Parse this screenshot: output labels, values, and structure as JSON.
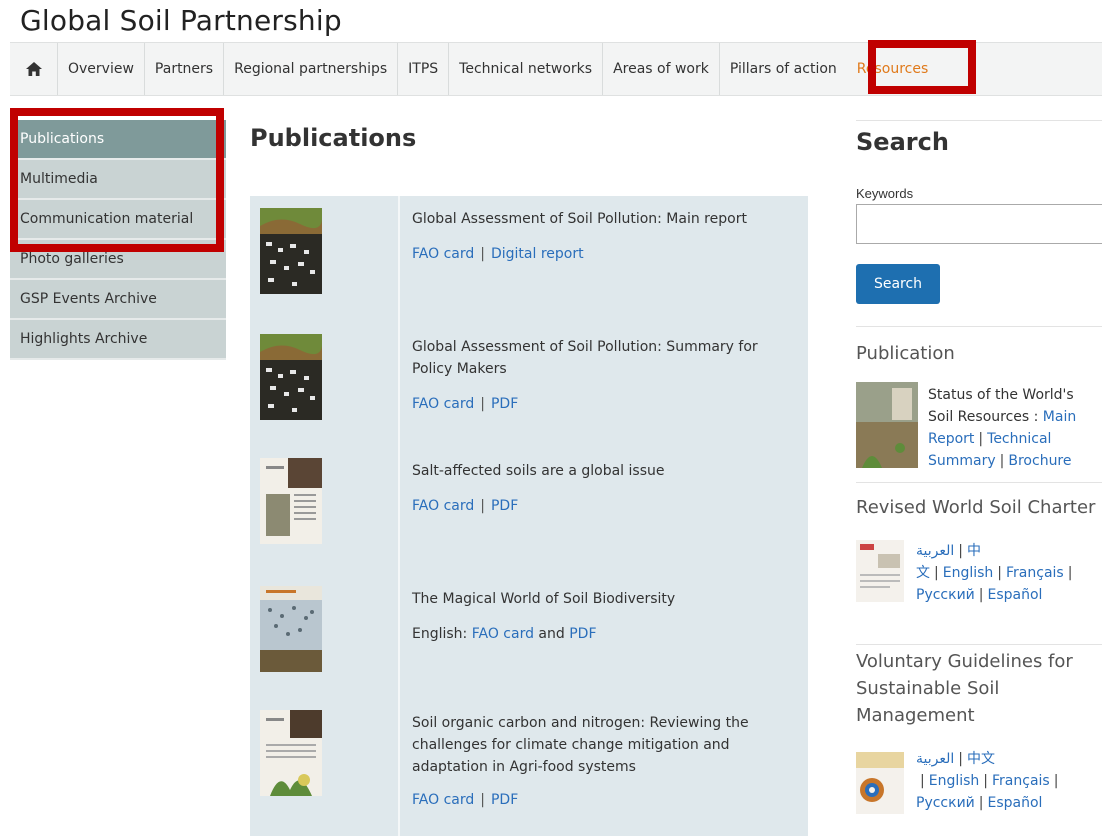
{
  "site": {
    "title": "Global Soil Partnership"
  },
  "nav": {
    "items": [
      {
        "label": "Overview"
      },
      {
        "label": "Partners"
      },
      {
        "label": "Regional partnerships"
      },
      {
        "label": "ITPS"
      },
      {
        "label": "Technical networks"
      },
      {
        "label": "Areas of work"
      },
      {
        "label": "Pillars of action"
      },
      {
        "label": "Resources",
        "active": true
      }
    ],
    "active_color": "#e07a1b",
    "home_icon": "home-icon"
  },
  "sidebar": {
    "items": [
      {
        "label": "Publications",
        "active": true
      },
      {
        "label": "Multimedia"
      },
      {
        "label": "Communication material"
      },
      {
        "label": "Photo galleries"
      },
      {
        "label": "GSP Events Archive"
      },
      {
        "label": "Highlights Archive"
      }
    ]
  },
  "main": {
    "title": "Publications",
    "publications": [
      {
        "title": "Global Assessment of Soil Pollution: Main report",
        "links": [
          "FAO card",
          "Digital report"
        ]
      },
      {
        "title": "Global Assessment of Soil Pollution: Summary for Policy Makers",
        "links": [
          "FAO card",
          "PDF"
        ]
      },
      {
        "title": "Salt-affected soils are a global issue",
        "links": [
          "FAO card",
          "PDF"
        ]
      },
      {
        "title": "The Magical World of Soil Biodiversity",
        "prefix": "English: ",
        "link_a": "FAO card",
        "joiner": " and ",
        "link_b": "PDF"
      },
      {
        "title": "Soil organic carbon and nitrogen: Reviewing the challenges for climate change mitigation and adaptation in Agri-food systems",
        "links": [
          "FAO card",
          "PDF"
        ]
      }
    ],
    "link_separator": "|"
  },
  "right": {
    "search": {
      "title": "Search",
      "keywords_label": "Keywords",
      "keywords_value": "",
      "button_label": "Search"
    },
    "publication": {
      "heading": "Publication",
      "text_a": "Status of the World's Soil Resources : ",
      "link_main": "Main Report",
      "link_technical": "Technical Summary",
      "link_brochure": "Brochure"
    },
    "charter": {
      "heading": "Revised World Soil Charter",
      "languages": [
        "العربية",
        "中文",
        "English",
        "Français",
        "Русский",
        "Español"
      ]
    },
    "guidelines": {
      "heading": "Voluntary Guidelines for Sustainable Soil Management",
      "languages": [
        "العربية",
        "中文",
        "English",
        "Français",
        "Русский",
        "Español"
      ]
    }
  },
  "colors": {
    "highlight_box": "#c00000",
    "sidebar_active": "#7f9a9a",
    "sidebar_bg": "#c9d3d3",
    "button": "#1e6fb0",
    "link": "#2a6ebb"
  }
}
